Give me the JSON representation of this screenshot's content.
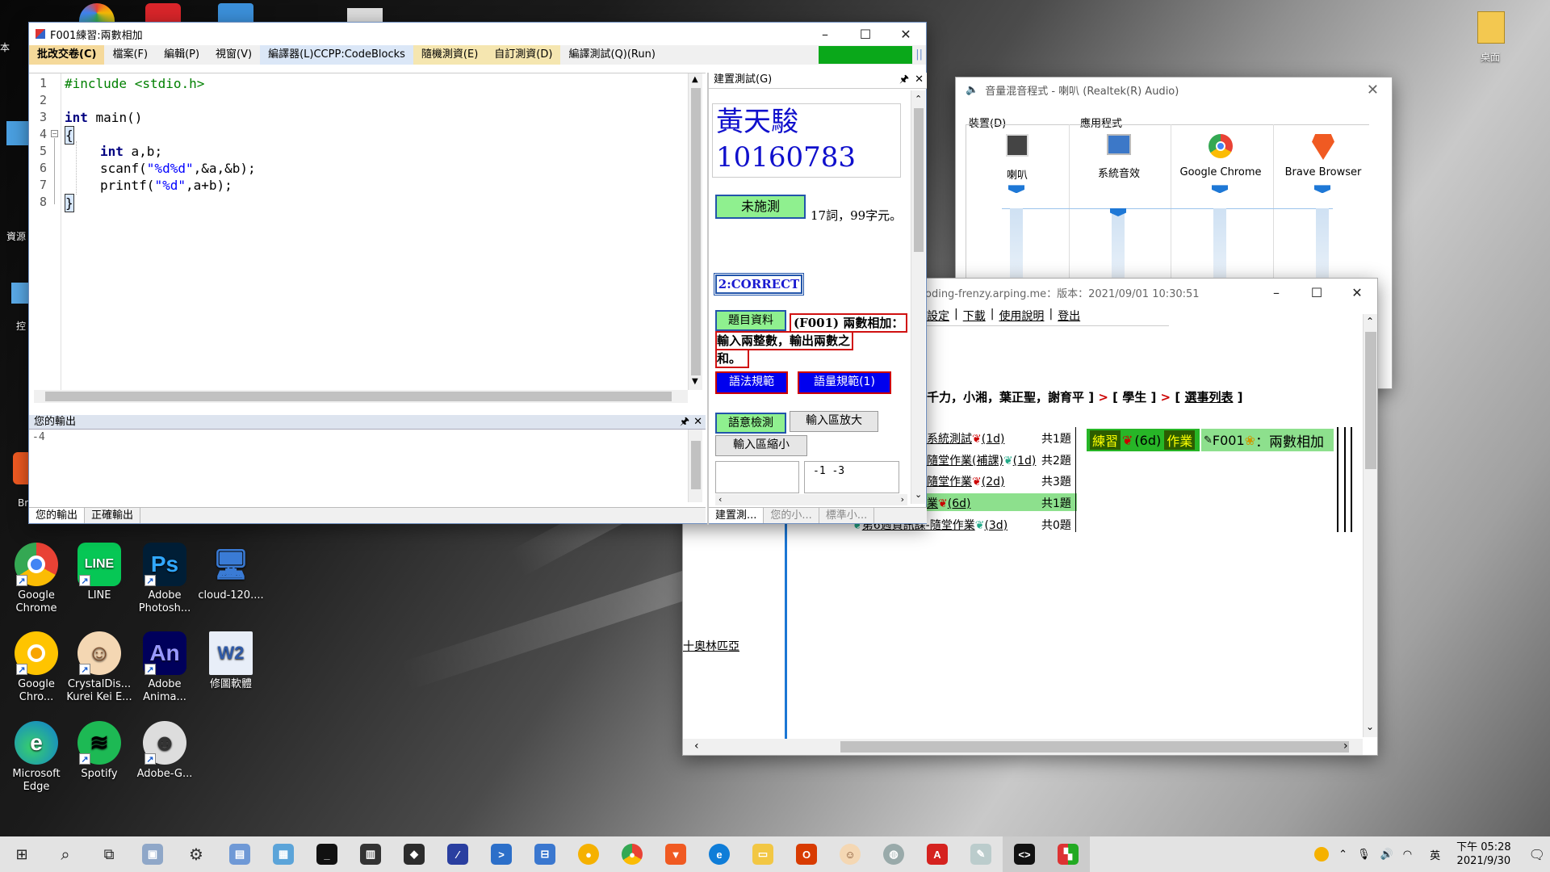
{
  "editor": {
    "title": "F001練習:兩數相加",
    "menu": [
      "批改交卷(C)",
      "檔案(F)",
      "編輯(P)",
      "視窗(V)",
      "編譯器(L)CCPP:CodeBlocks",
      "隨機測資(E)",
      "自訂測資(D)",
      "編譯測試(Q)(Run)"
    ],
    "line_numbers": [
      "1",
      "2",
      "3",
      "4",
      "5",
      "6",
      "7",
      "8"
    ],
    "code": {
      "l1": "#include <stdio.h>",
      "l3a": "int",
      "l3b": " main()",
      "l4": "{",
      "l5a": "int",
      "l5b": " a,b;",
      "l6a": "scanf(",
      "l6b": "\"%d%d\"",
      "l6c": ",&a,&b);",
      "l7a": "printf(",
      "l7b": "\"%d\"",
      "l7c": ",a+b);",
      "l8": "}"
    },
    "output_header": "您的輸出",
    "output_text": "-4",
    "output_tabs": [
      "您的輸出",
      "正確輸出"
    ]
  },
  "side_panel": {
    "header": "建置測試(G)",
    "student_name": "黃天駿",
    "student_id": "10160783",
    "status_button": "未施測",
    "stats_text": "17詞，99字元。",
    "correct_label": "2:CORRECT",
    "problem_button": "題目資料",
    "problem_title": "(F001) 兩數相加：",
    "problem_desc1": "輸入兩整數，輸出兩數之",
    "problem_desc2": "和。",
    "syntax_button": "語法規範",
    "semantic_button": "語量規範(1)",
    "grammar_check_button": "語意檢測",
    "input_enlarge_button": "輸入區放大",
    "input_shrink_button": "輸入區縮小",
    "test_input": "-1 -3",
    "tabs": [
      "建置測...",
      "您的小...",
      "標準小..."
    ]
  },
  "volume_mixer": {
    "title": "音量混音程式 - 喇叭 (Realtek(R) Audio)",
    "device_label": "裝置(D)",
    "apps_label": "應用程式",
    "columns": [
      {
        "name": "喇叭",
        "level": 0.82
      },
      {
        "name": "系統音效",
        "level": 0.6
      },
      {
        "name": "Google Chrome",
        "level": 0.82
      },
      {
        "name": "Brave Browser",
        "level": 0.82
      }
    ]
  },
  "browser": {
    "title": "oding-frenzy.arping.me：版本：2021/09/01 10:30:51",
    "nav_links": [
      "設定",
      "下載",
      "使用說明",
      "登出"
    ],
    "breadcrumb_names": "千力，小湘，葉正聖，謝育平 ]",
    "breadcrumb_role": "學生",
    "breadcrumb_list": "選事列表",
    "rows": [
      {
        "name": "系統測試",
        "days": "(1d)",
        "count": "共1題"
      },
      {
        "name": "隨堂作業(補課)",
        "days": "(1d)",
        "count": "共2題"
      },
      {
        "name": "隨堂作業",
        "days": "(2d)",
        "count": "共3題"
      },
      {
        "name": "業",
        "days": "(6d)",
        "count": "共1題"
      },
      {
        "name": "第6週資訊課-隨堂作業",
        "days": "(3d)",
        "count": "共0題"
      }
    ],
    "active_practice": "練習",
    "active_days": "(6d)",
    "active_homework": "作業",
    "active_problem": "F001",
    "active_problem_name": "：兩數相加",
    "bottom_link": "十奧林匹亞"
  },
  "desktop_icons": [
    {
      "label": "Google Chrome",
      "color": "#ffffff",
      "glyph": "◉"
    },
    {
      "label": "LINE",
      "color": "#06c755",
      "glyph": "LINE"
    },
    {
      "label": "Adobe Photosh...",
      "color": "#001e36",
      "glyph": "Ps"
    },
    {
      "label": "cloud-120....",
      "color": "#e8eef8",
      "glyph": "🖥"
    },
    {
      "label": "Google Chro...",
      "color": "#ffc400",
      "glyph": "◉"
    },
    {
      "label": "CrystalDis... Kurei Kei E...",
      "color": "#f4d7b3",
      "glyph": "☺"
    },
    {
      "label": "Adobe Anima...",
      "color": "#00005b",
      "glyph": "An"
    },
    {
      "label": "修圖軟體",
      "color": "#2f5aa8",
      "glyph": "W2"
    },
    {
      "label": "Microsoft Edge",
      "color": "#0f7dd8",
      "glyph": "e"
    },
    {
      "label": "Spotify",
      "color": "#1db954",
      "glyph": "≋"
    },
    {
      "label": "Adobe-G...",
      "color": "#dddddd",
      "glyph": "☻"
    }
  ],
  "desktop_left_labels": [
    "本",
    "資源",
    "控",
    "Br"
  ],
  "desktop_top_right_label": "桌面",
  "taskbar": {
    "ime": "英",
    "time": "下午 05:28",
    "date": "2021/9/30"
  }
}
